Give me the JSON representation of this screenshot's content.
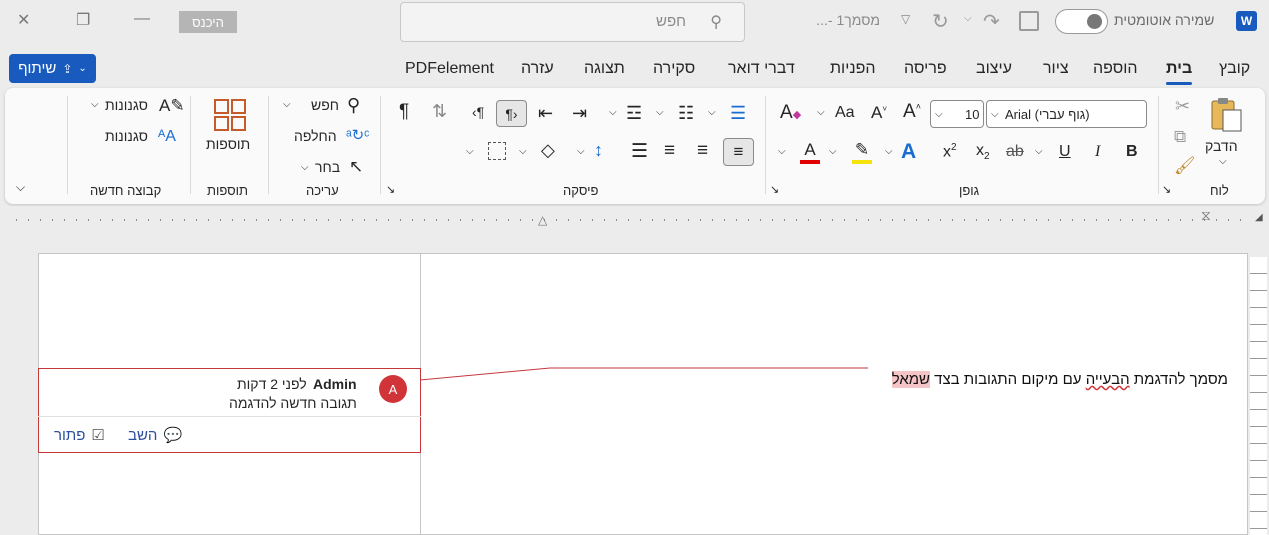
{
  "titlebar": {
    "app_logo": "W",
    "autosave_label": "שמירה אוטומטית",
    "doc_title": "מסמך1 -...",
    "search_placeholder": "חפש",
    "signin_label": "היכנס"
  },
  "tabs": {
    "file": "קובץ",
    "home": "בית",
    "insert": "הוספה",
    "draw": "ציור",
    "design": "עיצוב",
    "layout": "פריסה",
    "references": "הפניות",
    "mailings": "דברי דואר",
    "review": "סקירה",
    "view": "תצוגה",
    "help": "עזרה",
    "pdfelement": "PDFelement",
    "share": "שיתוף"
  },
  "ribbon": {
    "clipboard": {
      "paste": "הדבק",
      "group": "לוח"
    },
    "font": {
      "name": "Arial (גוף עברי)",
      "size": "10",
      "group": "גופן"
    },
    "paragraph": {
      "group": "פיסקה"
    },
    "editing": {
      "find": "חפש",
      "replace": "החלפה",
      "select": "בחר",
      "group": "עריכה"
    },
    "addins": {
      "label": "תוספות",
      "group": "תוספות"
    },
    "styles": {
      "styles1": "סגנונות",
      "styles2": "סגנונות",
      "group": "קבוצה חדשה"
    }
  },
  "comment": {
    "avatar": "A",
    "author": "Admin",
    "time": "לפני 2 דקות",
    "text": "תגובה חדשה להדגמה",
    "reply": "השב",
    "resolve": "פתור"
  },
  "document": {
    "text_before": "מסמך להדגמת ",
    "misspelled": "הבעייה",
    "text_middle": " עם מיקום התגובות בצד ",
    "highlighted": "שמאל"
  },
  "colors": {
    "accent": "#185abd",
    "comment_border": "#c5373a",
    "avatar": "#d13438",
    "highlight": "#f4c4c6"
  }
}
